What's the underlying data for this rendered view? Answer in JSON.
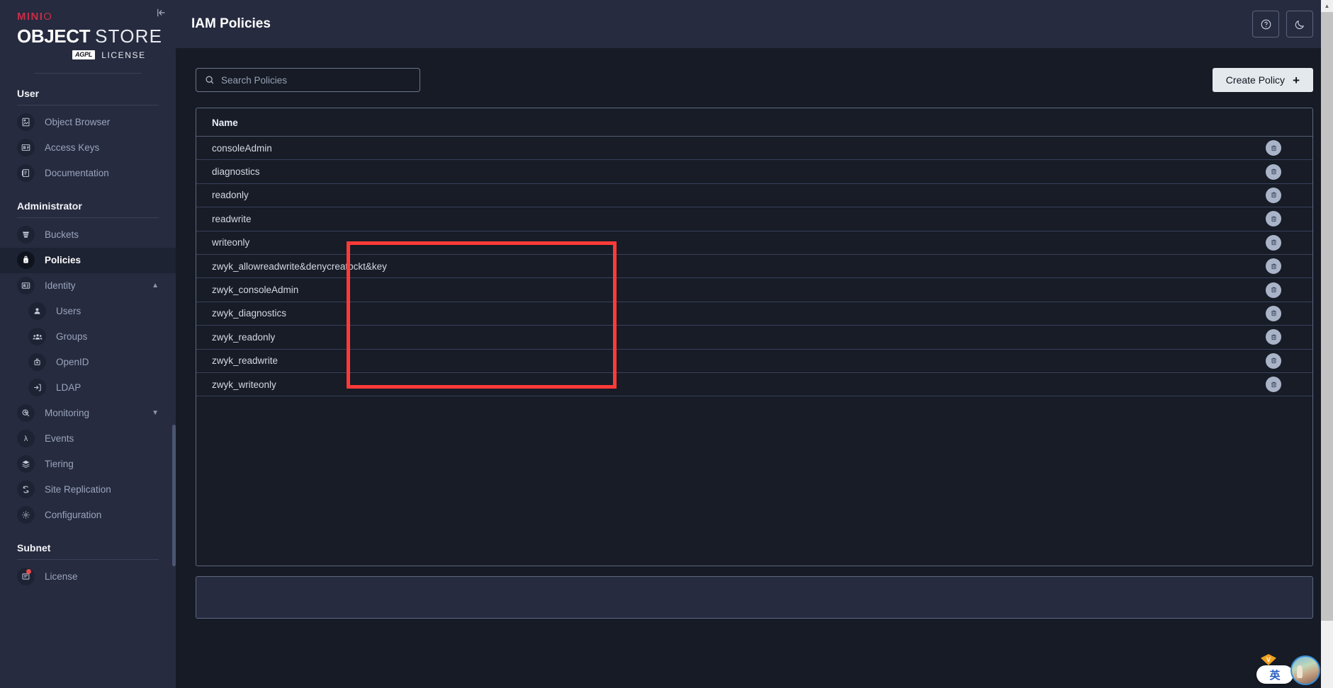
{
  "brand": {
    "minio": "MINI",
    "minio_suffix": "O",
    "object": "OBJECT",
    "store": "STORE",
    "agpl_badge": "AGPL",
    "license": "LICENSE",
    "collapse_icon": "sidebar-collapse-icon"
  },
  "sidebar": {
    "sections": [
      {
        "title": "User",
        "items": [
          {
            "label": "Object Browser",
            "icon": "object-browser-icon",
            "active": false,
            "child": false
          },
          {
            "label": "Access Keys",
            "icon": "access-keys-icon",
            "active": false,
            "child": false
          },
          {
            "label": "Documentation",
            "icon": "documentation-icon",
            "active": false,
            "child": false
          }
        ]
      },
      {
        "title": "Administrator",
        "items": [
          {
            "label": "Buckets",
            "icon": "bucket-icon",
            "active": false,
            "child": false
          },
          {
            "label": "Policies",
            "icon": "policy-icon",
            "active": true,
            "child": false
          },
          {
            "label": "Identity",
            "icon": "identity-icon",
            "active": false,
            "child": false,
            "chevron": "chevron-up"
          },
          {
            "label": "Users",
            "icon": "user-icon",
            "active": false,
            "child": true
          },
          {
            "label": "Groups",
            "icon": "groups-icon",
            "active": false,
            "child": true
          },
          {
            "label": "OpenID",
            "icon": "openid-icon",
            "active": false,
            "child": true
          },
          {
            "label": "LDAP",
            "icon": "ldap-icon",
            "active": false,
            "child": true
          },
          {
            "label": "Monitoring",
            "icon": "monitoring-icon",
            "active": false,
            "child": false,
            "chevron": "chevron-down"
          },
          {
            "label": "Events",
            "icon": "events-lambda-icon",
            "active": false,
            "child": false
          },
          {
            "label": "Tiering",
            "icon": "tiering-icon",
            "active": false,
            "child": false
          },
          {
            "label": "Site Replication",
            "icon": "site-replication-icon",
            "active": false,
            "child": false
          },
          {
            "label": "Configuration",
            "icon": "configuration-gear-icon",
            "active": false,
            "child": false
          }
        ]
      },
      {
        "title": "Subnet",
        "items": [
          {
            "label": "License",
            "icon": "license-icon",
            "active": false,
            "child": false,
            "dot": true
          }
        ]
      }
    ]
  },
  "header": {
    "title": "IAM Policies",
    "help_icon": "help-circle-icon",
    "theme_icon": "dark-mode-moon-icon"
  },
  "toolbar": {
    "search_placeholder": "Search Policies",
    "search_value": "",
    "search_icon": "search-icon",
    "create_label": "Create Policy",
    "create_plus": "+"
  },
  "table": {
    "columns": [
      "Name",
      ""
    ],
    "delete_icon": "trash-delete-icon",
    "rows": [
      {
        "name": "consoleAdmin",
        "highlighted": false
      },
      {
        "name": "diagnostics",
        "highlighted": false
      },
      {
        "name": "readonly",
        "highlighted": false
      },
      {
        "name": "readwrite",
        "highlighted": false
      },
      {
        "name": "writeonly",
        "highlighted": false
      },
      {
        "name": "zwyk_allowreadwrite&denycreatbckt&key",
        "highlighted": true
      },
      {
        "name": "zwyk_consoleAdmin",
        "highlighted": true
      },
      {
        "name": "zwyk_diagnostics",
        "highlighted": true
      },
      {
        "name": "zwyk_readonly",
        "highlighted": true
      },
      {
        "name": "zwyk_readwrite",
        "highlighted": true
      },
      {
        "name": "zwyk_writeonly",
        "highlighted": true
      }
    ]
  },
  "annotation": {
    "color": "#ff3b38",
    "name": "red-highlight-rectangle"
  },
  "tray": {
    "ime_label": "英",
    "avatar_icon": "user-avatar-image",
    "diamond_icon": "vip-diamond-icon"
  },
  "colors": {
    "sidebar_bg": "#262b3f",
    "content_bg": "#161b25",
    "accent_red": "#c72e49",
    "panel_bg": "#171c27",
    "button_light": "#e4e9ee"
  }
}
